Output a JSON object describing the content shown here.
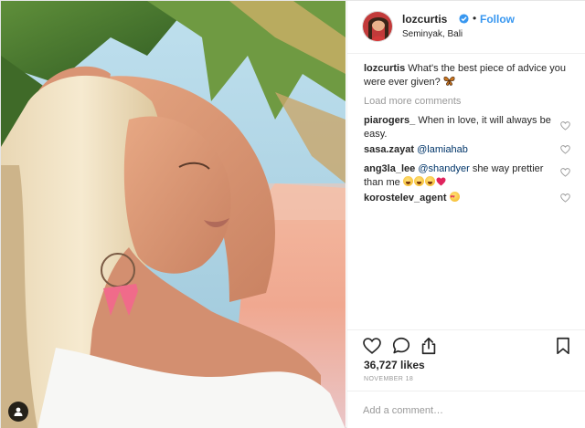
{
  "post": {
    "author": {
      "username": "lozcurtis",
      "verified": true,
      "follow_label": "Follow",
      "separator": "•",
      "location": "Seminyak, Bali"
    },
    "caption": {
      "username": "lozcurtis",
      "text": "What's the best piece of advice you were ever given?",
      "emoji": "butterfly"
    },
    "load_more_label": "Load more comments",
    "comments": [
      {
        "username": "piarogers_",
        "text": "When in love, it will always be easy."
      },
      {
        "username": "sasa.zayat",
        "mention": "@lamiahab",
        "text": ""
      },
      {
        "username": "ang3la_lee",
        "mention": "@shandyer",
        "text": "she way prettier than me",
        "emojis": [
          "laughing-crying",
          "laughing-crying",
          "laughing-crying",
          "red-heart"
        ]
      },
      {
        "username": "korostelev_agent",
        "text": "",
        "emojis": [
          "heart-eyes"
        ]
      }
    ],
    "likes_label": "36,727 likes",
    "date_label": "NOVEMBER 18",
    "add_comment_placeholder": "Add a comment…",
    "icons": {
      "like": "heart-icon",
      "comment": "comment-icon",
      "share": "share-icon",
      "save": "bookmark-icon",
      "tag": "user-tag-icon"
    },
    "colors": {
      "link": "#3897f0",
      "mention": "#003569",
      "muted": "#999999",
      "text": "#262626"
    }
  }
}
